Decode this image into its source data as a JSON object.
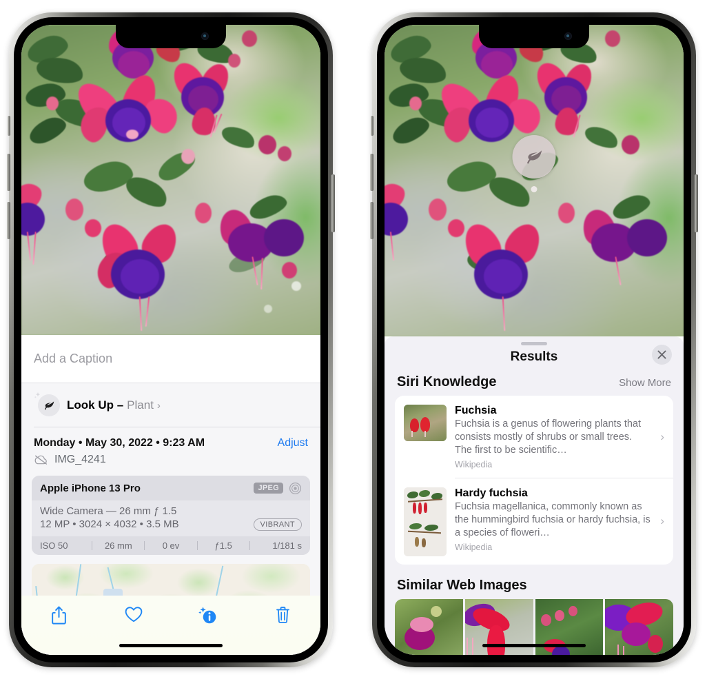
{
  "left_phone": {
    "caption": {
      "placeholder": "Add a Caption",
      "value": ""
    },
    "lookup": {
      "icon": "leaf-icon",
      "sparkle_icon": "sparkle-icon",
      "label": "Look Up –",
      "subject": "Plant",
      "chevron": "›"
    },
    "date_row": {
      "date_text": "Monday • May 30, 2022 • 9:23 AM",
      "adjust_label": "Adjust"
    },
    "file_row": {
      "cloud_icon": "cloud-slash-icon",
      "filename": "IMG_4241"
    },
    "camera_card": {
      "model": "Apple iPhone 13 Pro",
      "format_badge": "JPEG",
      "lens_icon": "aperture-icon",
      "lens_line": "Wide Camera — 26 mm ƒ 1.5",
      "specs_line": "12 MP • 3024 × 4032 • 3.5 MB",
      "style_badge": "VIBRANT",
      "exif": [
        "ISO 50",
        "26 mm",
        "0 ev",
        "ƒ1.5",
        "1/181 s"
      ]
    },
    "toolbar": [
      {
        "name": "share-icon",
        "glyph": "share"
      },
      {
        "name": "favorite-heart-icon",
        "glyph": "heart"
      },
      {
        "name": "info-visual-lookup-icon",
        "glyph": "info"
      },
      {
        "name": "delete-trash-icon",
        "glyph": "trash"
      }
    ]
  },
  "right_phone": {
    "leaf_badge": {
      "icon": "leaf-icon"
    },
    "results": {
      "title": "Results",
      "close_icon": "close-icon",
      "grabber": "drag-handle"
    },
    "siri_knowledge": {
      "section_title": "Siri Knowledge",
      "action_label": "Show More",
      "items": [
        {
          "title": "Fuchsia",
          "description": "Fuchsia is a genus of flowering plants that consists mostly of shrubs or small trees. The first to be scientific…",
          "source": "Wikipedia",
          "chevron": "›"
        },
        {
          "title": "Hardy fuchsia",
          "description": "Fuchsia magellanica, commonly known as the hummingbird fuchsia or hardy fuchsia, is a species of floweri…",
          "source": "Wikipedia",
          "chevron": "›"
        }
      ]
    },
    "similar_web_images": {
      "section_title": "Similar Web Images",
      "count": 4
    }
  },
  "colors": {
    "accent_blue": "#1f87f5",
    "sheet_bg": "#f2f1f6",
    "card_bg": "#ffffff",
    "muted_text": "#74747b",
    "link_gray": "#7b7b83"
  }
}
